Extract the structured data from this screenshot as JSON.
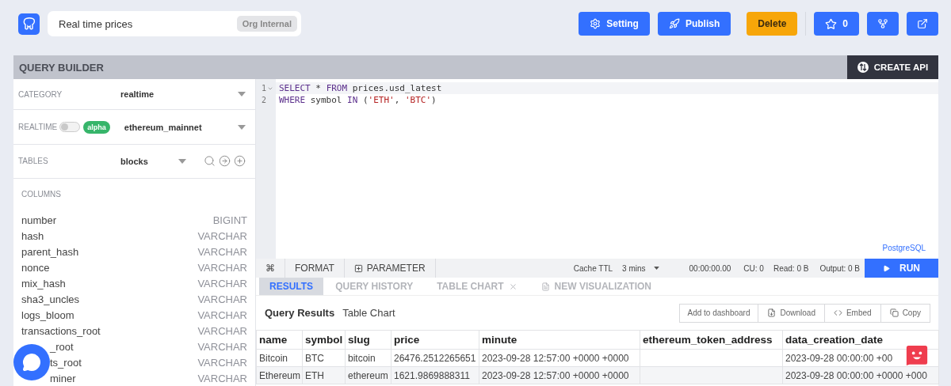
{
  "header": {
    "title": "Real time prices",
    "visibility": "Org Internal",
    "buttons": [
      {
        "kind": "gear",
        "label": "Setting"
      },
      {
        "kind": "rocket",
        "label": "Publish"
      },
      {
        "kind": "danger",
        "label": "Delete"
      },
      {
        "kind": "star",
        "label": "0"
      },
      {
        "kind": "fork"
      },
      {
        "kind": "external"
      }
    ]
  },
  "builder": {
    "title": "QUERY BUILDER",
    "create_api": "CREATE API",
    "category": {
      "label": "CATEGORY",
      "value": "realtime"
    },
    "realtime": {
      "label": "REALTIME",
      "on": false,
      "badge": "alpha",
      "value": "ethereum_mainnet"
    },
    "tables": {
      "label": "TABLES",
      "value": "blocks"
    },
    "columns_label": "COLUMNS",
    "columns": [
      {
        "name": "number",
        "type": "BIGINT",
        "covered": false
      },
      {
        "name": "hash",
        "type": "VARCHAR",
        "covered": false
      },
      {
        "name": "parent_hash",
        "type": "VARCHAR",
        "covered": false
      },
      {
        "name": "nonce",
        "type": "VARCHAR",
        "covered": false
      },
      {
        "name": "mix_hash",
        "type": "VARCHAR",
        "covered": false
      },
      {
        "name": "sha3_uncles",
        "type": "VARCHAR",
        "covered": false
      },
      {
        "name": "logs_bloom",
        "type": "VARCHAR",
        "covered": false
      },
      {
        "name": "transactions_root",
        "type": "VARCHAR",
        "covered": false
      },
      {
        "name": "_root",
        "type": "VARCHAR",
        "covered": true
      },
      {
        "name": "ts_root",
        "type": "VARCHAR",
        "covered": true
      },
      {
        "name": "miner",
        "type": "VARCHAR",
        "covered": true
      }
    ]
  },
  "editor": {
    "lines": [
      {
        "number": "1",
        "foldable": true,
        "tokens": [
          {
            "kind": "keyword",
            "text": "SELECT"
          },
          {
            "kind": "plain",
            "text": " * "
          },
          {
            "kind": "keyword",
            "text": "FROM"
          },
          {
            "kind": "plain",
            "text": " prices.usd_latest"
          }
        ]
      },
      {
        "number": "2",
        "foldable": false,
        "tokens": [
          {
            "kind": "keyword",
            "text": "WHERE"
          },
          {
            "kind": "plain",
            "text": " symbol "
          },
          {
            "kind": "keyword",
            "text": "IN"
          },
          {
            "kind": "plain",
            "text": " ("
          },
          {
            "kind": "string",
            "text": "'ETH'"
          },
          {
            "kind": "plain",
            "text": ", "
          },
          {
            "kind": "string",
            "text": "'BTC'"
          },
          {
            "kind": "plain",
            "text": ")"
          }
        ]
      }
    ],
    "dialect": "PostgreSQL"
  },
  "toolbar": {
    "shortcut": "⌘",
    "format": "FORMAT",
    "parameter": "PARAMETER",
    "cache_label": "Cache TTL",
    "cache_value": "3 mins",
    "duration": "00:00:00.00",
    "cu": "CU: 0",
    "read": "Read: 0 B",
    "output": "Output: 0 B",
    "run": "RUN"
  },
  "result_tabs": [
    {
      "label": "RESULTS",
      "selected": true,
      "kind": "plain"
    },
    {
      "label": "QUERY HISTORY",
      "selected": false,
      "kind": "plain"
    },
    {
      "label": "TABLE CHART",
      "selected": false,
      "kind": "closable"
    },
    {
      "label": "NEW VISUALIZATION",
      "selected": false,
      "kind": "doc"
    }
  ],
  "results": {
    "title": "Query Results",
    "subtitle": "Table Chart",
    "actions": [
      {
        "kind": "none",
        "label": "Add to dashboard"
      },
      {
        "kind": "download",
        "label": "Download"
      },
      {
        "kind": "embed",
        "label": "Embed"
      },
      {
        "kind": "copy",
        "label": "Copy"
      }
    ],
    "table": {
      "columns": [
        "name",
        "symbol",
        "slug",
        "price",
        "minute",
        "ethereum_token_address",
        "data_creation_date"
      ],
      "rows": [
        [
          "Bitcoin",
          "BTC",
          "bitcoin",
          "26476.2512265651",
          "2023-09-28 12:57:00 +0000 +0000",
          "",
          "2023-09-28 00:00:00 +00"
        ],
        [
          "Ethereum",
          "ETH",
          "ethereum",
          "1621.9869888311",
          "2023-09-28 12:57:00 +0000 +0000",
          "",
          "2023-09-28 00:00:00 +0000 +000"
        ]
      ]
    }
  }
}
